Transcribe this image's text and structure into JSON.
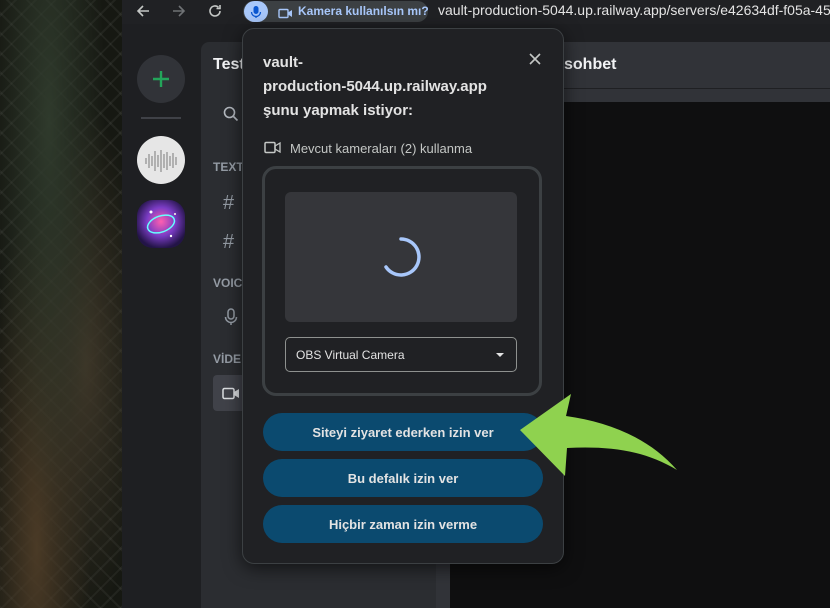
{
  "browser": {
    "permission_chip_label": "Kamera kullanılsın mı?",
    "url": "vault-production-5044.up.railway.app/servers/e42634df-f05a-45"
  },
  "discord": {
    "server_name": "Test",
    "channel_header": "sohbet",
    "categories": [
      "TEXT",
      "VOIC",
      "VİDE"
    ]
  },
  "prompt": {
    "host_line1": "vault-",
    "host_line2": "production-5044.up.railway.app",
    "request_line": "şunu yapmak istiyor:",
    "permission_text": "Mevcut kameraları (2) kullanma",
    "camera_select_value": "OBS Virtual Camera",
    "buttons": {
      "allow_while_visiting": "Siteyi ziyaret ederken izin ver",
      "allow_this_time": "Bu defalık izin ver",
      "never_allow": "Hiçbir zaman izin verme"
    }
  },
  "colors": {
    "button_bg": "#0b4a6f",
    "accent_arrow": "#8fd24f",
    "add_server_green": "#23a55a",
    "spinner": "#a8c7fa"
  }
}
